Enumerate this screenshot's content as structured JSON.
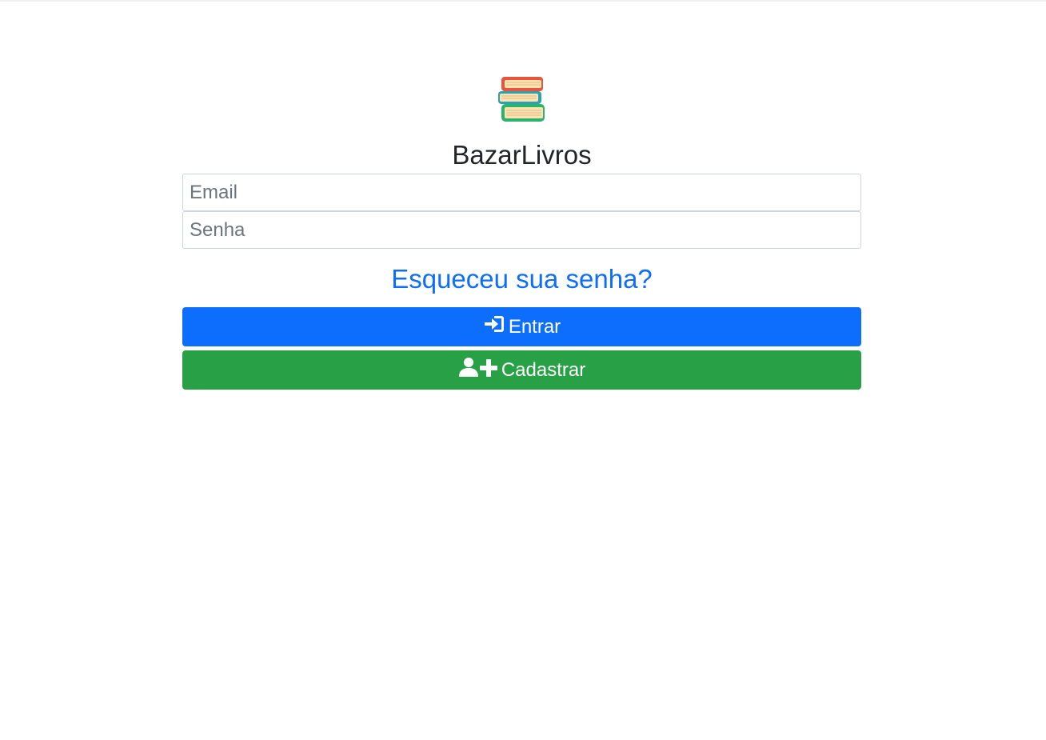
{
  "app": {
    "brand_name": "BazarLivros",
    "logo_icon": "books-stack-icon"
  },
  "form": {
    "email_placeholder": "Email",
    "email_value": "",
    "password_placeholder": "Senha",
    "password_value": "",
    "forgot_link": "Esqueceu sua senha?",
    "login_button": {
      "label": "Entrar",
      "icon": "sign-in-icon"
    },
    "register_button": {
      "label": "Cadastrar",
      "icon": "user-plus-icon"
    }
  },
  "colors": {
    "primary": "#0d6efd",
    "success": "#28a046",
    "link": "#0d6efd",
    "text": "#212529"
  }
}
